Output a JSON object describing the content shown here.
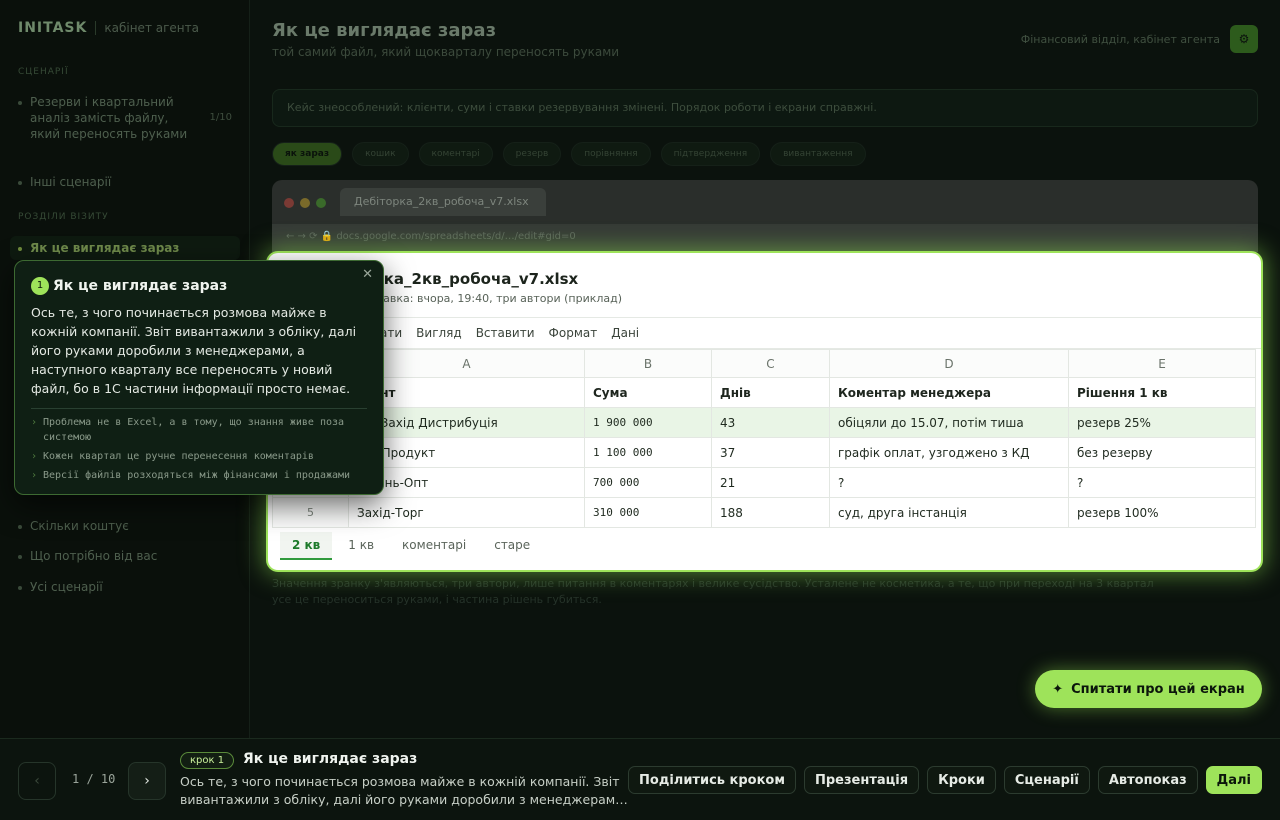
{
  "brand": {
    "name": "INITASK",
    "sub": "кабінет агента"
  },
  "sidebar": {
    "section1": "СЦЕНАРІЇ",
    "scenario": "Резерви і квартальний аналіз замість файлу, який переносять руками",
    "scenario_count": "1/10",
    "other": "Інші сценарії",
    "section2": "РОЗДІЛИ ВІЗИТУ",
    "active": "Як це виглядає зараз",
    "items": [
      "Скільки коштує",
      "Що потрібно від вас",
      "Усі сценарії"
    ]
  },
  "header": {
    "title": "Як це виглядає зараз",
    "subtitle": "той самий файл, який щокварталу переносять руками",
    "right": "Фінансовий відділ, кабінет агента"
  },
  "notice": "Кейс знеособлений: клієнти, суми і ставки резервування змінені. Порядок роботи і екрани справжні.",
  "tabs": [
    "як зараз",
    "кошик",
    "коментарі",
    "резерв",
    "порівняння",
    "підтвердження",
    "вивантаження"
  ],
  "browser": {
    "tab": "Дебіторка_2кв_робоча_v7.xlsx",
    "url": "docs.google.com/spreadsheets/d/…/edit#gid=0"
  },
  "sheet": {
    "file_name": "…рка_2кв_робоча_v7.xlsx",
    "meta": "…правка: вчора, 19:40, три автори (приклад)",
    "menu": [
      "…ати",
      "Вигляд",
      "Вставити",
      "Формат",
      "Дані"
    ],
    "col_letters": [
      "",
      "A",
      "B",
      "C",
      "D",
      "E"
    ],
    "header": [
      "…ієнт",
      "Сума",
      "Днів",
      "Коментар менеджера",
      "Рішення 1 кв"
    ],
    "rows": [
      {
        "n": "",
        "c": [
          "…о-Захід Дистрибуція",
          "1 900 000",
          "43",
          "обіцяли до 15.07, потім тиша",
          "резерв 25%"
        ]
      },
      {
        "n": "",
        "c": [
          "…д-Продукт",
          "1 100 000",
          "37",
          "графік оплат, узгоджено з КД",
          "без резерву"
        ]
      },
      {
        "n": "",
        "c": [
          "…день-Опт",
          "700 000",
          "21",
          "?",
          "?"
        ]
      },
      {
        "n": "5",
        "c": [
          "Захід-Торг",
          "310 000",
          "188",
          "суд, друга інстанція",
          "резерв 100%"
        ]
      }
    ],
    "sheet_tabs": [
      "2 кв",
      "1 кв",
      "коментарі",
      "старе"
    ]
  },
  "caption": "Значення зранку з'являються, три автори, лише питання в коментарях і велике сусідство. Усталене не косметика, а те, що при переході на 3 квартал усе це переноситься руками, і частина рішень губиться.",
  "popover": {
    "num": "1",
    "title": "Як це виглядає зараз",
    "body": "Ось те, з чого починається розмова майже в кожній компанії. Звіт вивантажили з обліку, далі його руками доробили з менеджерами, а наступного кварталу все переносять у новий файл, бо в 1С частини інформації просто немає.",
    "points": [
      "Проблема не в Excel, а в тому, що знання живе поза системою",
      "Кожен квартал це ручне перенесення коментарів",
      "Версії файлів розходяться між фінансами і продажами"
    ]
  },
  "ask_button": "Спитати про цей екран",
  "footer": {
    "page": "1 / 10",
    "step_badge": "крок 1",
    "step_title": "Як це виглядає зараз",
    "step_text": "Ось те, з чого починається розмова майже в кожній компанії. Звіт вивантажили з обліку, далі його руками доробили з менеджерам…",
    "buttons": [
      "Поділитись кроком",
      "Презентація",
      "Кроки",
      "Сценарії",
      "Автопоказ",
      "Далі"
    ]
  }
}
